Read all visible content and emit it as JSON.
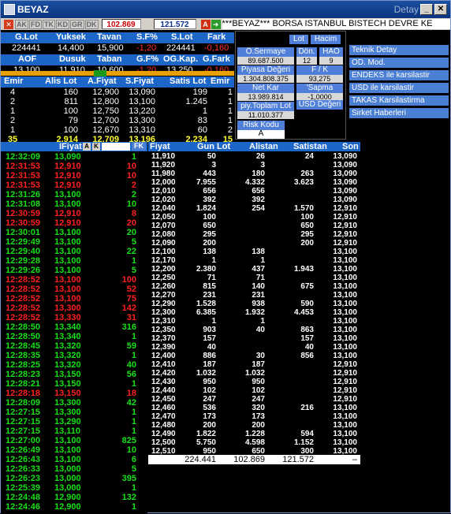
{
  "window": {
    "title": "BEYAZ",
    "detay": "Detay",
    "min": "_",
    "max": "□",
    "close": "✕"
  },
  "toolbar": {
    "buttons": [
      "AK",
      "FD",
      "TK",
      "KD",
      "GR",
      "DK"
    ],
    "value1": "102.869",
    "value2": "121.572",
    "a_label": "A",
    "ticker": "***BEYAZ*** BORSA ISTANBUL BISTECH DEVRE KE"
  },
  "summary": {
    "h1": [
      "G.Lot",
      "Yuksek",
      "Tavan",
      "S.F%",
      "S.Lot",
      "Fark"
    ],
    "r1": [
      "224441",
      "14,400",
      "15,900",
      "-1,20",
      "224441",
      "-0,160"
    ],
    "h2": [
      "AOF",
      "Dusuk",
      "Taban",
      "G.F%",
      "OG.Kap.",
      "G.Fark"
    ],
    "r2": [
      "13,100",
      "11,910",
      "10,600",
      "-1,20",
      "13,250",
      "-0,160"
    ]
  },
  "depth": {
    "headers": [
      "Emir",
      "Alis Lot",
      "A.Fiyat",
      "S.Fiyat",
      "Satis Lot",
      "Emir"
    ],
    "rows": [
      [
        "4",
        "160",
        "12,900",
        "13,090",
        "199",
        "1"
      ],
      [
        "2",
        "811",
        "12,800",
        "13,100",
        "1.245",
        "1"
      ],
      [
        "1",
        "100",
        "12,750",
        "13,220",
        "1",
        "1"
      ],
      [
        "2",
        "79",
        "12,700",
        "13,300",
        "83",
        "1"
      ],
      [
        "1",
        "100",
        "12,670",
        "13,310",
        "60",
        "2"
      ]
    ],
    "totals": [
      "35",
      "2.914",
      "12,709",
      "13,196",
      "2.234",
      "15"
    ]
  },
  "info": {
    "lot": "Lot",
    "hacim": "Hacim",
    "osermaye": "Ö.Sermaye",
    "osermaye_val": "89.687.500",
    "don": "Dön.",
    "don_val": "12",
    "hao": "HAO",
    "hao_val": "9",
    "piyasa": "Piyasa Değeri",
    "piyasa_val": "1.304.808.375",
    "fk": "F / K",
    "fk_val": "93,275",
    "netkar": "Net Kar",
    "netkar_val": "13.989.814",
    "sapma": "'Sapma",
    "sapma_val": "-1,0000",
    "toplamlot": "piy.Toplam Lot",
    "toplamlot_val": "11.010.377",
    "usd": "USD Değeri",
    "risk": "Risk Kodu",
    "risk_val": "A"
  },
  "menu": [
    "Teknik Detay",
    "OD. Mod.",
    "ENDEKS ile karsilastir",
    "USD ile karsilastir",
    "TAKAS Karsilastirma",
    "Sirket Haberleri"
  ],
  "trades": {
    "header": "IFiyat",
    "h_a": "A",
    "h_k": "K",
    "h_fk": "FK",
    "rows": [
      [
        "12:32:09",
        "13,090",
        "1",
        "g"
      ],
      [
        "12:31:53",
        "12,910",
        "10",
        "r"
      ],
      [
        "12:31:53",
        "12,910",
        "10",
        "r"
      ],
      [
        "12:31:53",
        "12,910",
        "2",
        "r"
      ],
      [
        "12:31:26",
        "13,100",
        "2",
        "g"
      ],
      [
        "12:31:08",
        "13,100",
        "10",
        "g"
      ],
      [
        "12:30:59",
        "12,910",
        "8",
        "r"
      ],
      [
        "12:30:59",
        "12,910",
        "20",
        "r"
      ],
      [
        "12:30:01",
        "13,100",
        "20",
        "g"
      ],
      [
        "12:29:49",
        "13,100",
        "5",
        "g"
      ],
      [
        "12:29:40",
        "13,100",
        "22",
        "g"
      ],
      [
        "12:29:28",
        "13,100",
        "1",
        "g"
      ],
      [
        "12:29:26",
        "13,100",
        "5",
        "g"
      ],
      [
        "12:28:52",
        "13,100",
        "100",
        "r"
      ],
      [
        "12:28:52",
        "13,100",
        "52",
        "r"
      ],
      [
        "12:28:52",
        "13,100",
        "75",
        "r"
      ],
      [
        "12:28:52",
        "13,300",
        "142",
        "r"
      ],
      [
        "12:28:52",
        "13,330",
        "31",
        "r"
      ],
      [
        "12:28:50",
        "13,340",
        "316",
        "g"
      ],
      [
        "12:28:50",
        "13,340",
        "1",
        "g"
      ],
      [
        "12:28:45",
        "13,320",
        "59",
        "g"
      ],
      [
        "12:28:35",
        "13,320",
        "1",
        "g"
      ],
      [
        "12:28:25",
        "13,320",
        "40",
        "g"
      ],
      [
        "12:28:23",
        "13,150",
        "56",
        "g"
      ],
      [
        "12:28:21",
        "13,150",
        "1",
        "g"
      ],
      [
        "12:28:18",
        "13,150",
        "18",
        "r"
      ],
      [
        "12:28:09",
        "13,300",
        "42",
        "g"
      ],
      [
        "12:27:15",
        "13,300",
        "1",
        "g"
      ],
      [
        "12:27:15",
        "13,290",
        "1",
        "g"
      ],
      [
        "12:27:15",
        "13,110",
        "1",
        "g"
      ],
      [
        "12:27:00",
        "13,100",
        "825",
        "g"
      ],
      [
        "12:26:49",
        "13,100",
        "10",
        "g"
      ],
      [
        "12:26:43",
        "13,100",
        "6",
        "g"
      ],
      [
        "12:26:33",
        "13,000",
        "5",
        "g"
      ],
      [
        "12:26:23",
        "13,000",
        "395",
        "g"
      ],
      [
        "12:25:39",
        "13,000",
        "1",
        "g"
      ],
      [
        "12:24:48",
        "12,900",
        "132",
        "g"
      ],
      [
        "12:24:46",
        "12,900",
        "1",
        "g"
      ]
    ]
  },
  "dist": {
    "headers": [
      "Fiyat",
      "Gun Lot",
      "Alistan",
      "Satistan",
      "Son"
    ],
    "rows": [
      [
        "11,910",
        "50",
        "26",
        "24",
        "13,090"
      ],
      [
        "11,920",
        "3",
        "3",
        "",
        "13,090"
      ],
      [
        "11,980",
        "443",
        "180",
        "263",
        "13,090"
      ],
      [
        "12,000",
        "7.955",
        "4.332",
        "3.623",
        "13,090"
      ],
      [
        "12,010",
        "656",
        "656",
        "",
        "13,090"
      ],
      [
        "12,020",
        "392",
        "392",
        "",
        "13,090"
      ],
      [
        "12,040",
        "1.824",
        "254",
        "1.570",
        "12,910"
      ],
      [
        "12,050",
        "100",
        "",
        "100",
        "12,910"
      ],
      [
        "12,070",
        "650",
        "",
        "650",
        "12,910"
      ],
      [
        "12,080",
        "295",
        "",
        "295",
        "12,910"
      ],
      [
        "12,090",
        "200",
        "",
        "200",
        "12,910"
      ],
      [
        "12,100",
        "138",
        "138",
        "",
        "13,100"
      ],
      [
        "12,170",
        "1",
        "1",
        "",
        "13,100"
      ],
      [
        "12,200",
        "2.380",
        "437",
        "1.943",
        "13,100"
      ],
      [
        "12,250",
        "71",
        "71",
        "",
        "13,100"
      ],
      [
        "12,260",
        "815",
        "140",
        "675",
        "13,100"
      ],
      [
        "12,270",
        "231",
        "231",
        "",
        "13,100"
      ],
      [
        "12,290",
        "1.528",
        "938",
        "590",
        "13,100"
      ],
      [
        "12,300",
        "6.385",
        "1.932",
        "4.453",
        "13,100"
      ],
      [
        "12,310",
        "1",
        "1",
        "",
        "13,100"
      ],
      [
        "12,350",
        "903",
        "40",
        "863",
        "13,100"
      ],
      [
        "12,370",
        "157",
        "",
        "157",
        "13,100"
      ],
      [
        "12,390",
        "40",
        "",
        "40",
        "13,100"
      ],
      [
        "12,400",
        "886",
        "30",
        "856",
        "13,100"
      ],
      [
        "12,410",
        "187",
        "187",
        "",
        "12,910"
      ],
      [
        "12,420",
        "1.032",
        "1.032",
        "",
        "12,910"
      ],
      [
        "12,430",
        "950",
        "950",
        "",
        "12,910"
      ],
      [
        "12,440",
        "102",
        "102",
        "",
        "12,910"
      ],
      [
        "12,450",
        "247",
        "247",
        "",
        "12,910"
      ],
      [
        "12,460",
        "536",
        "320",
        "216",
        "13,100"
      ],
      [
        "12,470",
        "173",
        "173",
        "",
        "13,100"
      ],
      [
        "12,480",
        "200",
        "200",
        "",
        "13,100"
      ],
      [
        "12,490",
        "1.822",
        "1.228",
        "594",
        "13,100"
      ],
      [
        "12,500",
        "5.750",
        "4.598",
        "1.152",
        "13,100"
      ],
      [
        "12,510",
        "950",
        "650",
        "300",
        "13,100"
      ]
    ],
    "totals": [
      "224.441",
      "102.869",
      "121.572",
      "–"
    ]
  }
}
